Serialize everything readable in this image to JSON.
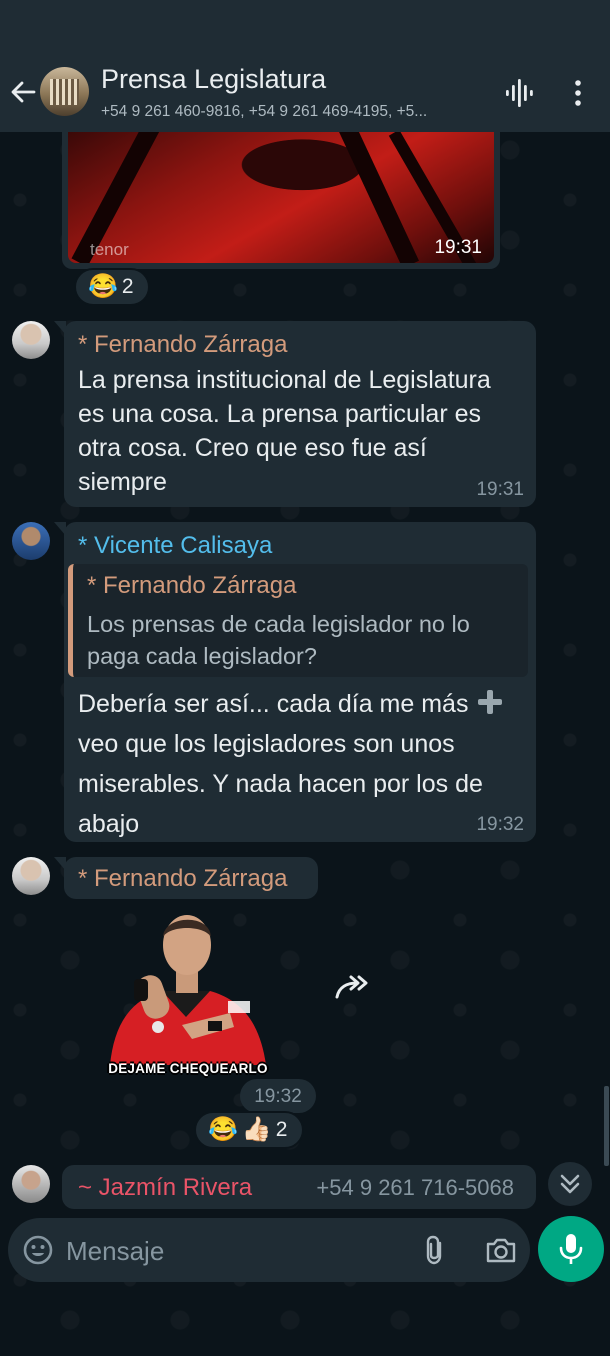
{
  "header": {
    "title": "Prensa Legislatura",
    "subtitle": "+54 9 261 460-9816, +54 9 261 469-4195, +5..."
  },
  "media_message": {
    "watermark": "tenor",
    "time": "19:31",
    "reaction": {
      "emoji": "😂",
      "count": "2"
    }
  },
  "messages": [
    {
      "sender": "* Fernando Zárraga",
      "sender_color": "#d39b7c",
      "text": "La prensa institucional de Legislatura es una cosa. La prensa particular es otra cosa. Creo que eso fue así siempre",
      "time": "19:31"
    },
    {
      "sender": "* Vicente Calisaya",
      "sender_color": "#53bdeb",
      "quote": {
        "sender": "* Fernando Zárraga",
        "text": "Los prensas de cada legislador no lo paga cada legislador?"
      },
      "text_before_icon": "Debería ser así... cada día me más",
      "icon": "heavy-plus-icon",
      "text_after_icon": "veo que los legisladores son unos miserables. Y nada hacen por los de abajo",
      "time": "19:32"
    },
    {
      "sender": "* Fernando Zárraga",
      "sender_color": "#d39b7c",
      "sticker_caption": "DEJAME CHEQUEARLO",
      "time": "19:32",
      "reactions": {
        "emoji1": "😂",
        "emoji2": "👍🏻",
        "count": "2"
      }
    }
  ],
  "last_sender": {
    "name": "~ Jazmín Rivera",
    "name_color": "#ea5468",
    "phone": "+54 9 261 716-5068"
  },
  "composer": {
    "placeholder": "Mensaje"
  },
  "colors": {
    "accent": "#00a884",
    "bubble": "#1f2c34",
    "background": "#0b141a"
  }
}
